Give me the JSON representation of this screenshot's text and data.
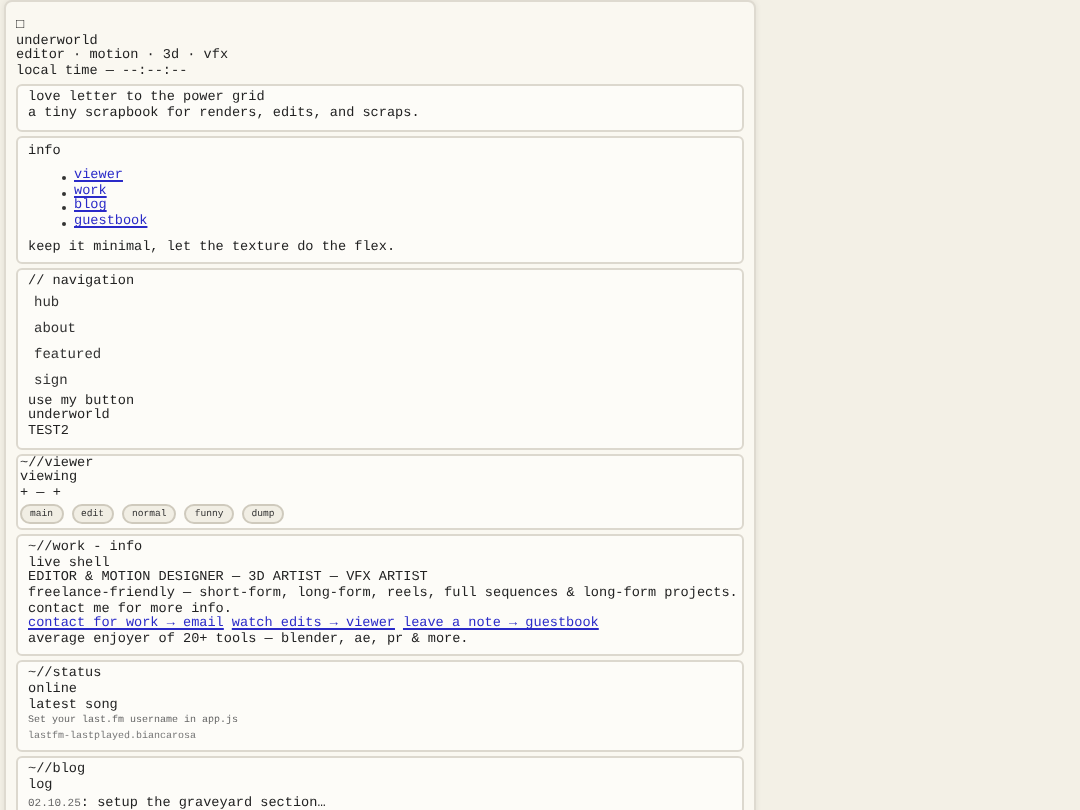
{
  "header": {
    "icon": "□",
    "name": "underworld",
    "tagline": "editor · motion · 3d · vfx",
    "local_time": "local time — --:--:--"
  },
  "intro": {
    "lines": [
      "love letter to the power grid",
      "a tiny scrapbook for renders, edits, and scraps."
    ]
  },
  "info": {
    "title": "info",
    "links": [
      "viewer",
      "work",
      "blog",
      "guestbook"
    ],
    "note": "keep it minimal, let the texture do the flex."
  },
  "navigation": {
    "title": "// navigation",
    "items": [
      "hub",
      "about",
      "featured",
      "sign"
    ],
    "lines": [
      "use my button",
      "underworld",
      "TEST2"
    ]
  },
  "viewer": {
    "title": "~//viewer",
    "label": "viewing",
    "controls": "+ — +",
    "chips": [
      "main",
      "edit",
      "normal",
      "funny",
      "dump"
    ]
  },
  "work": {
    "title": "~//work - info",
    "subtitle": "live shell",
    "role": "EDITOR & MOTION DESIGNER — 3D ARTIST — VFX ARTIST",
    "description": [
      "freelance-friendly — short-form, long-form, reels, full sequences & long-form projects.",
      "contact me for more info."
    ],
    "links": [
      "contact for work → email",
      "watch edits → viewer",
      "leave a note → guestbook"
    ],
    "footer": "average enjoyer of 20+ tools — blender, ae, pr & more."
  },
  "status": {
    "title": "~//status",
    "state": "online",
    "song_label": "latest song",
    "hint": "Set your last.fm username in app.js",
    "source": "lastfm-lastplayed.biancarosa"
  },
  "blog": {
    "title": "~//blog",
    "label": "log",
    "entries": [
      {
        "date": "02.10.25",
        "text": ": setup the graveyard section…"
      }
    ]
  }
}
